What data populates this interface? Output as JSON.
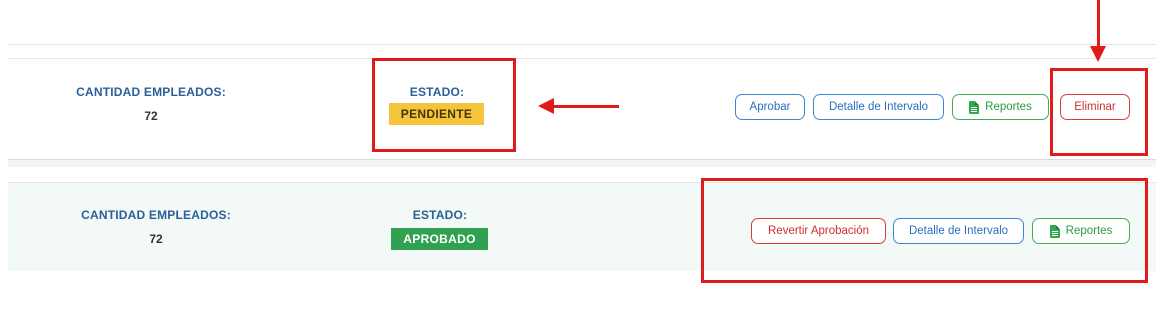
{
  "rows": [
    {
      "employees_label": "CANTIDAD EMPLEADOS:",
      "employees_count": "72",
      "status_label": "ESTADO:",
      "status_value": "PENDIENTE",
      "buttons": {
        "approve": "Aprobar",
        "interval_detail": "Detalle de Intervalo",
        "reports": "Reportes",
        "delete": "Eliminar"
      }
    },
    {
      "employees_label": "CANTIDAD EMPLEADOS:",
      "employees_count": "72",
      "status_label": "ESTADO:",
      "status_value": "APROBADO",
      "buttons": {
        "revert_approval": "Revertir Aprobación",
        "interval_detail": "Detalle de Intervalo",
        "reports": "Reportes"
      }
    }
  ],
  "icons": {
    "reports": "document-icon",
    "annotation_arrows": "red-arrow-icon"
  },
  "colors": {
    "label_blue": "#2a5f98",
    "pending_badge": "#f5c43d",
    "approved_badge": "#2fa150",
    "button_blue": "#3a86d6",
    "button_green": "#3fae55",
    "button_red": "#dc3b3b",
    "annotation_red": "#e01b1b",
    "approved_row_bg": "#f3f9f6"
  }
}
